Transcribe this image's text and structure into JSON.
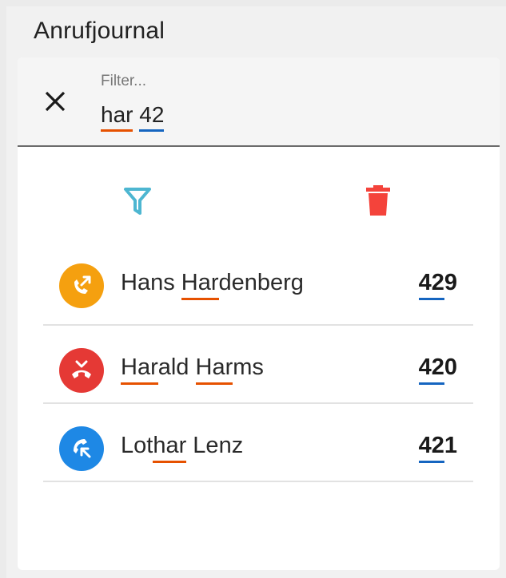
{
  "header": {
    "title": "Anrufjournal"
  },
  "filter": {
    "label": "Filter...",
    "value_parts": [
      "har",
      " ",
      "42"
    ]
  },
  "colors": {
    "outgoing": "#f5a00f",
    "missed": "#e53935",
    "incoming": "#1e88e5",
    "filter_icon": "#4db6d1",
    "delete_icon": "#f4433b",
    "highlight_name": "#e65100",
    "highlight_number": "#1565c0"
  },
  "calls": [
    {
      "icon": "outgoing-call-icon",
      "name_parts": [
        "Hans ",
        "Har",
        "denberg"
      ],
      "number_parts": [
        "42",
        "9"
      ]
    },
    {
      "icon": "missed-call-icon",
      "name_parts": [
        "",
        "Har",
        "ald ",
        "Har",
        "ms"
      ],
      "number_parts": [
        "42",
        "0"
      ]
    },
    {
      "icon": "incoming-call-icon",
      "name_parts": [
        "Lot",
        "har",
        " Lenz"
      ],
      "number_parts": [
        "42",
        "1"
      ]
    }
  ]
}
